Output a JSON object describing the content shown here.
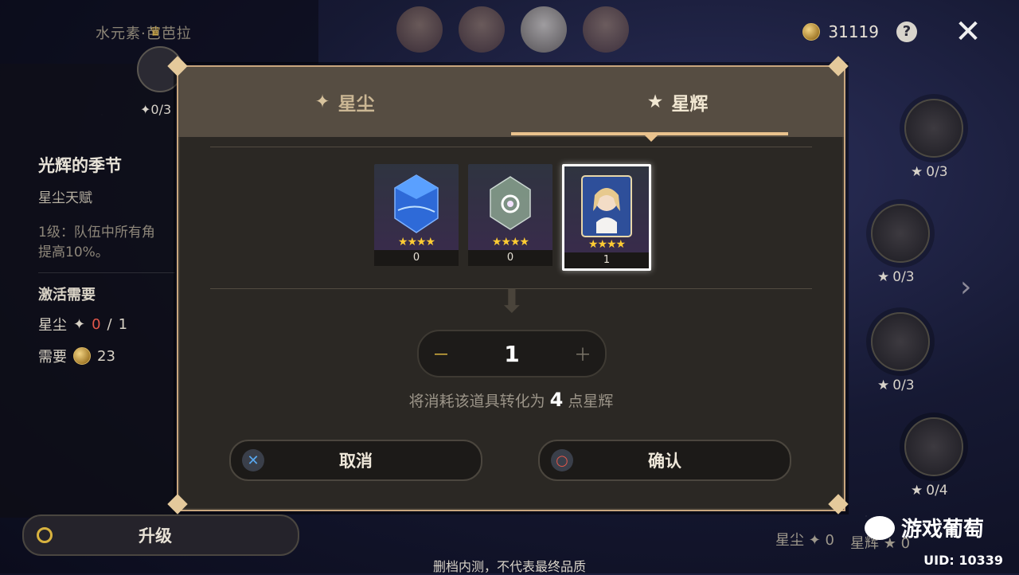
{
  "header": {
    "title": "水元素·芭芭拉",
    "mora": "31119",
    "help_label": "?",
    "close_label": "✕"
  },
  "left": {
    "node_count": "0/3",
    "talent_title": "光辉的季节",
    "talent_type": "星尘天赋",
    "talent_desc_1": "1级：队伍中所有角",
    "talent_desc_2": "提高10%。",
    "req_title": "激活需要",
    "req_stardust_label": "星尘",
    "req_stardust_have": "0",
    "req_stardust_sep": "/",
    "req_stardust_need": "1",
    "req_mora_label": "需要",
    "req_mora_value": "23",
    "upgrade_label": "升级"
  },
  "right_nodes": [
    {
      "count": "0/3"
    },
    {
      "count": "0/3"
    },
    {
      "count": "0/3"
    },
    {
      "count": "0/4"
    }
  ],
  "bottom": {
    "stardust_label": "星尘",
    "stardust_value": "0",
    "starglitter_label": "星辉",
    "starglitter_value": "0",
    "uid": "UID: 10339",
    "watermark": "游戏葡萄",
    "disclaimer": "删档内测，不代表最终品质"
  },
  "modal": {
    "tabs": [
      {
        "label": "星尘",
        "icon": "sparkle-icon",
        "active": false
      },
      {
        "label": "星辉",
        "icon": "star-icon",
        "active": true
      }
    ],
    "items": [
      {
        "name": "blue-crystal",
        "stars": "★★★★",
        "count": "0",
        "selected": false
      },
      {
        "name": "prism-crystal",
        "stars": "★★★★",
        "count": "0",
        "selected": false
      },
      {
        "name": "barbara-card",
        "stars": "★★★★",
        "count": "1",
        "selected": true
      }
    ],
    "stepper": {
      "minus": "－",
      "value": "1",
      "plus": "＋"
    },
    "convert_prefix": "将消耗该道具转化为",
    "convert_amount": "4",
    "convert_suffix": "点星辉",
    "cancel_label": "取消",
    "confirm_label": "确认"
  },
  "colors": {
    "accent_gold": "#e9c28d",
    "star_yellow": "#ffcc33",
    "warning_red": "#e2574a"
  }
}
